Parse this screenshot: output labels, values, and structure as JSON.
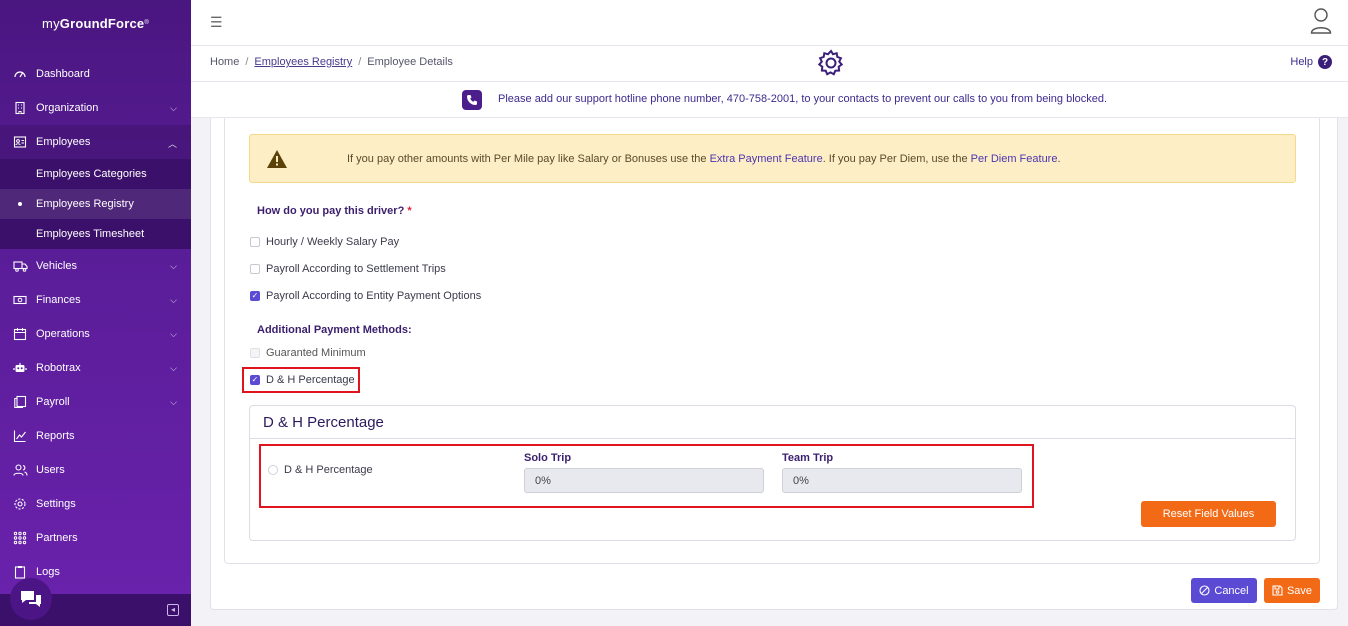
{
  "app": {
    "logo_prefix": "my",
    "logo_brand": "GroundForce",
    "logo_reg": "®"
  },
  "sidebar": {
    "items": [
      {
        "label": "Dashboard",
        "icon": "dashboard-icon"
      },
      {
        "label": "Organization",
        "icon": "building-icon",
        "chevron": "down"
      },
      {
        "label": "Employees",
        "icon": "id-card-icon",
        "chevron": "up"
      },
      {
        "label": "Vehicles",
        "icon": "truck-icon",
        "chevron": "down"
      },
      {
        "label": "Finances",
        "icon": "money-icon",
        "chevron": "down"
      },
      {
        "label": "Operations",
        "icon": "calendar-icon",
        "chevron": "down"
      },
      {
        "label": "Robotrax",
        "icon": "robot-icon",
        "chevron": "down"
      },
      {
        "label": "Payroll",
        "icon": "copy-icon",
        "chevron": "down"
      },
      {
        "label": "Reports",
        "icon": "chart-icon"
      },
      {
        "label": "Users",
        "icon": "users-icon"
      },
      {
        "label": "Settings",
        "icon": "gear-icon"
      },
      {
        "label": "Partners",
        "icon": "grid-icon"
      },
      {
        "label": "Logs",
        "icon": "clipboard-icon"
      }
    ],
    "employees_sub": [
      {
        "label": "Employees Categories"
      },
      {
        "label": "Employees Registry",
        "active": true
      },
      {
        "label": "Employees Timesheet"
      }
    ]
  },
  "breadcrumb": {
    "home": "Home",
    "sep": "/",
    "registry": "Employees Registry",
    "current": "Employee Details"
  },
  "help": {
    "label": "Help",
    "q": "?"
  },
  "notice": {
    "text": "Please add our support hotline phone number, 470-758-2001, to your contacts to prevent our calls to you from being blocked."
  },
  "alert": {
    "part1": "If you pay other amounts with Per Mile pay like Salary or Bonuses use the ",
    "link1": "Extra Payment Feature",
    "part2": ". If you pay Per Diem, use the ",
    "link2": "Per Diem Feature",
    "part3": "."
  },
  "form": {
    "question": "How do you pay this driver?",
    "required": "*",
    "options": [
      {
        "label": "Hourly / Weekly Salary Pay",
        "checked": false
      },
      {
        "label": "Payroll According to Settlement Trips",
        "checked": false
      },
      {
        "label": "Payroll According to Entity Payment Options",
        "checked": true
      }
    ],
    "additional_label": "Additional Payment Methods:",
    "additional": [
      {
        "label": "Guaranted Minimum",
        "checked": false,
        "disabled": true
      },
      {
        "label": "D & H Percentage",
        "checked": true
      }
    ]
  },
  "dh_panel": {
    "title": "D & H Percentage",
    "radio_label": "D & H Percentage",
    "solo_label": "Solo Trip",
    "solo_value": "0%",
    "team_label": "Team Trip",
    "team_value": "0%",
    "reset_label": "Reset Field Values"
  },
  "actions": {
    "cancel": "Cancel",
    "save": "Save"
  },
  "colors": {
    "sidebar": "#5a1d98",
    "accent": "#5b4bd4",
    "orange": "#f26a16",
    "highlight": "#e0141e"
  }
}
